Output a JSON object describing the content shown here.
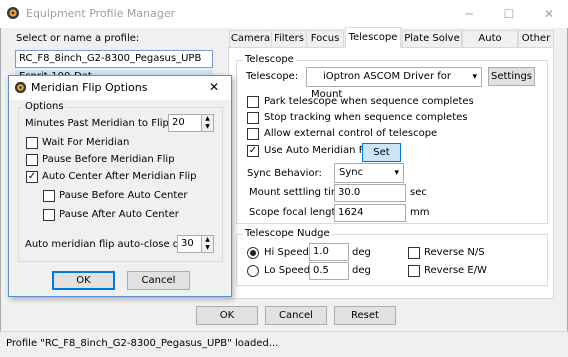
{
  "window": {
    "title": "Equipment Profile Manager",
    "minimize": "─",
    "maximize": "☐",
    "close": "✕"
  },
  "profiles": {
    "label": "Select or name a profile:",
    "current": "RC_F8_8inch_G2-8300_Pegasus_UPB",
    "second_partial": "Esprit-100-Dat"
  },
  "tabs": [
    "Camera",
    "Filters",
    "Focus",
    "Telescope",
    "Plate Solve",
    "Auto Guide",
    "Other"
  ],
  "active_tab": "Telescope",
  "telescope": {
    "group_title": "Telescope",
    "label": "Telescope:",
    "driver": "iOptron ASCOM Driver for Mount",
    "settings_button": "Settings",
    "checkboxes": [
      {
        "label": "Park telescope when sequence completes",
        "checked": false
      },
      {
        "label": "Stop tracking when sequence completes",
        "checked": false
      },
      {
        "label": "Allow external control of telescope",
        "checked": false
      },
      {
        "label": "Use Auto Meridian Flip",
        "checked": true
      }
    ],
    "set_button": "Set",
    "sync_label": "Sync Behavior:",
    "sync_value": "Sync",
    "settling_label": "Mount settling time:",
    "settling_value": "30.0",
    "settling_unit": "sec",
    "focal_label": "Scope focal length:",
    "focal_value": "1624",
    "focal_unit": "mm"
  },
  "nudge": {
    "group_title": "Telescope Nudge",
    "hi_label": "Hi Speed",
    "hi_value": "1.0",
    "lo_label": "Lo Speed",
    "lo_value": "0.5",
    "unit": "deg",
    "selected": "Hi Speed",
    "reverse_ns": "Reverse N/S",
    "reverse_ew": "Reverse E/W",
    "reverse_ns_checked": false,
    "reverse_ew_checked": false
  },
  "footer": {
    "ok": "OK",
    "cancel": "Cancel",
    "reset": "Reset",
    "status": "Profile \"RC_F8_8inch_G2-8300_Pegasus_UPB\" loaded..."
  },
  "dialog": {
    "title": "Meridian Flip Options",
    "close": "✕",
    "group_title": "Options",
    "minutes_label": "Minutes Past Meridian to Flip:",
    "minutes_value": "20",
    "checks": [
      {
        "label": "Wait For Meridian",
        "checked": false
      },
      {
        "label": "Pause Before Meridian Flip",
        "checked": false
      },
      {
        "label": "Auto Center After Meridian Flip",
        "checked": true
      },
      {
        "label": "Pause Before Auto Center",
        "checked": false
      },
      {
        "label": "Pause After Auto Center",
        "checked": false
      }
    ],
    "delay_label": "Auto meridian flip auto-close delay",
    "delay_value": "30",
    "ok": "OK",
    "cancel": "Cancel"
  },
  "colors": {
    "accent": "#0078d7",
    "dialog_border": "#5a8fd6"
  },
  "icons": [
    "app-icon",
    "dialog-app-icon",
    "dropdown-arrow-icon",
    "spin-up-icon",
    "spin-down-icon",
    "check-icon"
  ]
}
